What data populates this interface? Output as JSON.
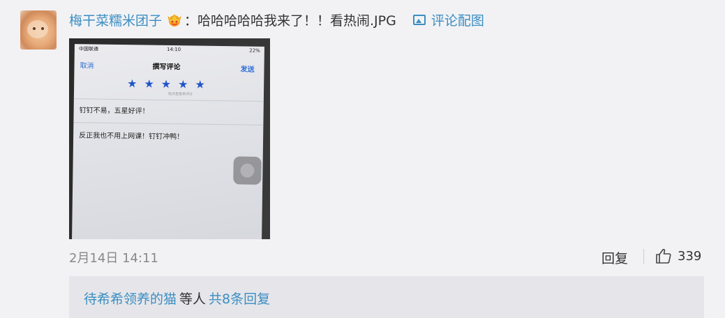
{
  "comment": {
    "username": "梅干菜糯米团子",
    "badge_icon": "crown-badge-icon",
    "content": "：哈哈哈哈哈我来了！！看热闹.JPG",
    "attachment_link": "评论配图",
    "timestamp": "2月14日 14:11",
    "reply_label": "回复",
    "like_count": "339"
  },
  "photo": {
    "status_carrier": "中国联通",
    "status_time": "14:10",
    "status_battery": "22%",
    "nav_cancel": "取消",
    "nav_title": "撰写评论",
    "nav_send": "发送",
    "stars": [
      "★",
      "★",
      "★",
      "★",
      "★"
    ],
    "star_hint": "轻点星星来评分",
    "review_title": "钉钉不易，五星好评！",
    "review_body": "反正我也不用上网课！钉钉冲鸭！"
  },
  "sub_replies": {
    "first_user": "待希希领养的猫",
    "middle_text": "等人",
    "count_link": "共8条回复"
  },
  "colors": {
    "link": "#3b8ec2",
    "background": "#f2f2f5",
    "sub_background": "#e6e6ea",
    "star": "#1f54c9"
  }
}
